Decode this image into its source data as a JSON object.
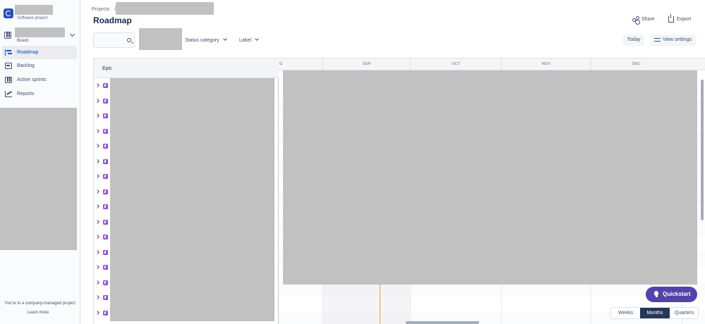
{
  "sidebar": {
    "project_type": "Software project",
    "board_label": "Board",
    "nav": [
      {
        "label": "Roadmap",
        "icon": "roadmap-icon",
        "active": true
      },
      {
        "label": "Backlog",
        "icon": "backlog-icon",
        "active": false
      },
      {
        "label": "Active sprints",
        "icon": "active-sprints-icon",
        "active": false
      },
      {
        "label": "Reports",
        "icon": "reports-icon",
        "active": false
      }
    ],
    "managed_text": "You're in a company-managed project",
    "learn_more": "Learn more"
  },
  "header": {
    "breadcrumb_root": "Projects",
    "breadcrumb_sep": "/",
    "title": "Roadmap",
    "share_label": "Share",
    "export_label": "Export"
  },
  "filters": {
    "status_category": "Status category",
    "label": "Label",
    "today": "Today",
    "view_settings": "View settings"
  },
  "roadmap": {
    "epic_header": "Epic",
    "months": [
      "G",
      "SEP",
      "OCT",
      "NOV",
      "DEC"
    ]
  },
  "quickstart": "Quickstart",
  "view_toggle": {
    "options": [
      "Weeks",
      "Months",
      "Quarters"
    ],
    "selected": "Months"
  },
  "colors": {
    "accent": "#0052cc",
    "epic": "#904ee2",
    "quickstart": "#5243aa",
    "today_line": "#ff991f",
    "toggle_selected": "#253858"
  }
}
